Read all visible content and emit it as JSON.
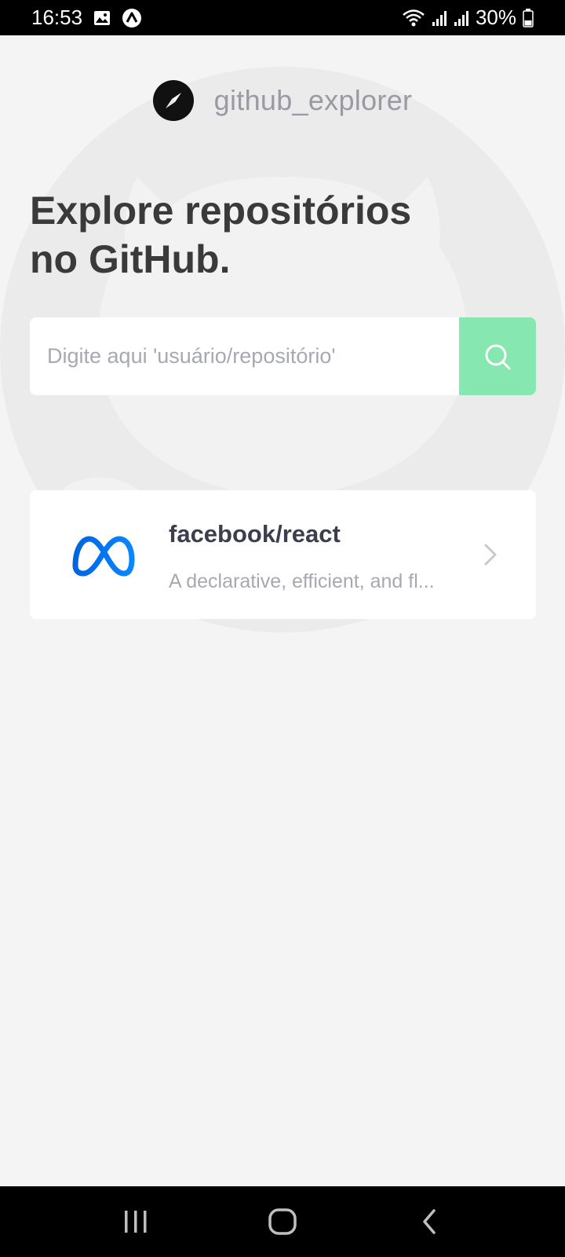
{
  "status_bar": {
    "time": "16:53",
    "battery": "30%",
    "icons": [
      "image-icon",
      "app-notification-icon",
      "wifi-icon",
      "signal-icon",
      "signal-icon",
      "battery-icon"
    ]
  },
  "header": {
    "app_name": "github_explorer",
    "logo_icon": "compass-icon"
  },
  "main": {
    "title_line1": "Explore repositórios",
    "title_line2": "no GitHub.",
    "search": {
      "placeholder": "Digite aqui 'usuário/repositório'",
      "value": "",
      "button_icon": "search-icon"
    },
    "repositories": [
      {
        "name": "facebook/react",
        "description": "A declarative, efficient, and fl...",
        "avatar_icon": "meta-logo-icon"
      }
    ]
  },
  "nav_bar": {
    "buttons": [
      "recent-apps-icon",
      "home-icon",
      "back-icon"
    ]
  },
  "colors": {
    "background": "#f4f4f4",
    "search_button": "#86e8b0",
    "title_text": "#3a3a3a",
    "muted_text": "#a8a8b3",
    "meta_blue": "#0a7cff"
  }
}
